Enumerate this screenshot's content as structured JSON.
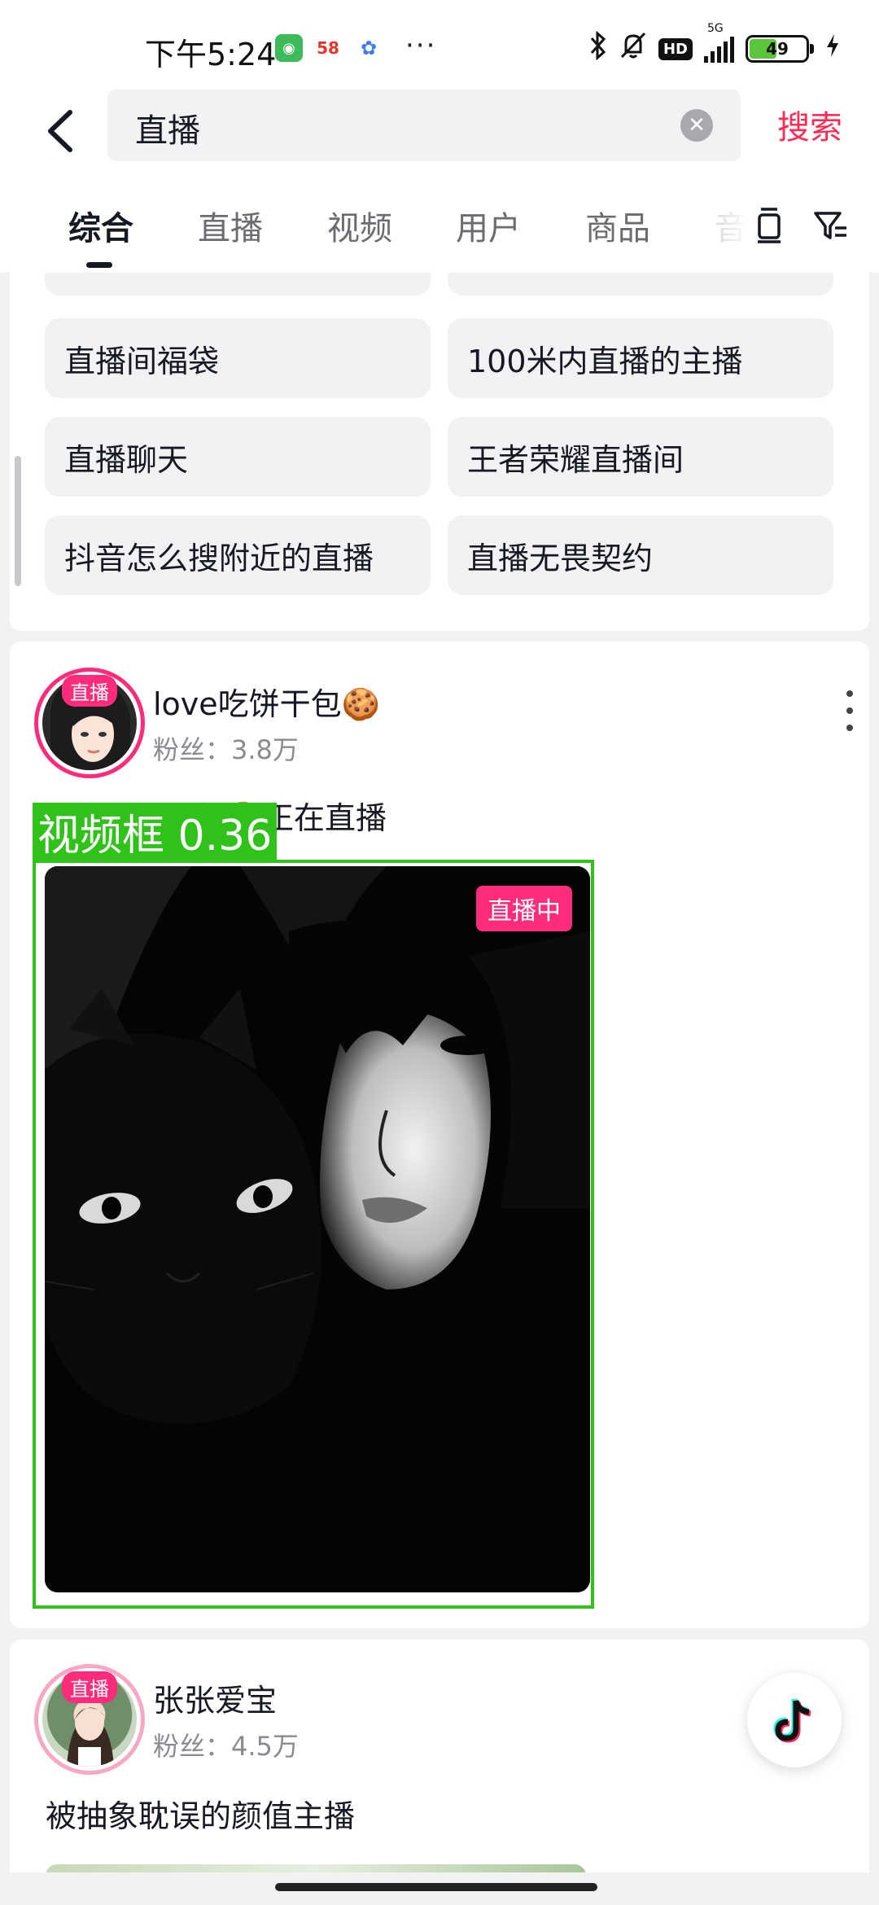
{
  "status_bar": {
    "time": "下午5:24",
    "app_icons": [
      "wechat-icon",
      "58-app-icon",
      "cloud-app-icon"
    ],
    "dots": "···",
    "network": "5G",
    "hd": "HD",
    "battery": "49",
    "battery_level": 0.49
  },
  "search": {
    "query": "直播",
    "search_button": "搜索"
  },
  "tabs": [
    "综合",
    "直播",
    "视频",
    "用户",
    "商品",
    "音"
  ],
  "active_tab": 0,
  "suggestions": [
    "直播间福袋",
    "100米内直播的主播",
    "直播聊天",
    "王者荣耀直播间",
    "抖音怎么搜附近的直播",
    "直播无畏契约"
  ],
  "results": [
    {
      "badge": "直播",
      "name": "love吃饼干包🍪",
      "fans": "粉丝：3.8万",
      "desc": "love吃饼干包🍪正在直播",
      "live_tag": "直播中"
    },
    {
      "badge": "直播",
      "name": "张张爱宝",
      "fans": "粉丝：4.5万",
      "desc": "被抽象耽误的颜值主播"
    }
  ],
  "detection": {
    "label": "视频框 0.36"
  },
  "colors": {
    "accent": "#fe2c55",
    "live_pink": "#fe2c7a",
    "detect_green": "#30c21a"
  }
}
